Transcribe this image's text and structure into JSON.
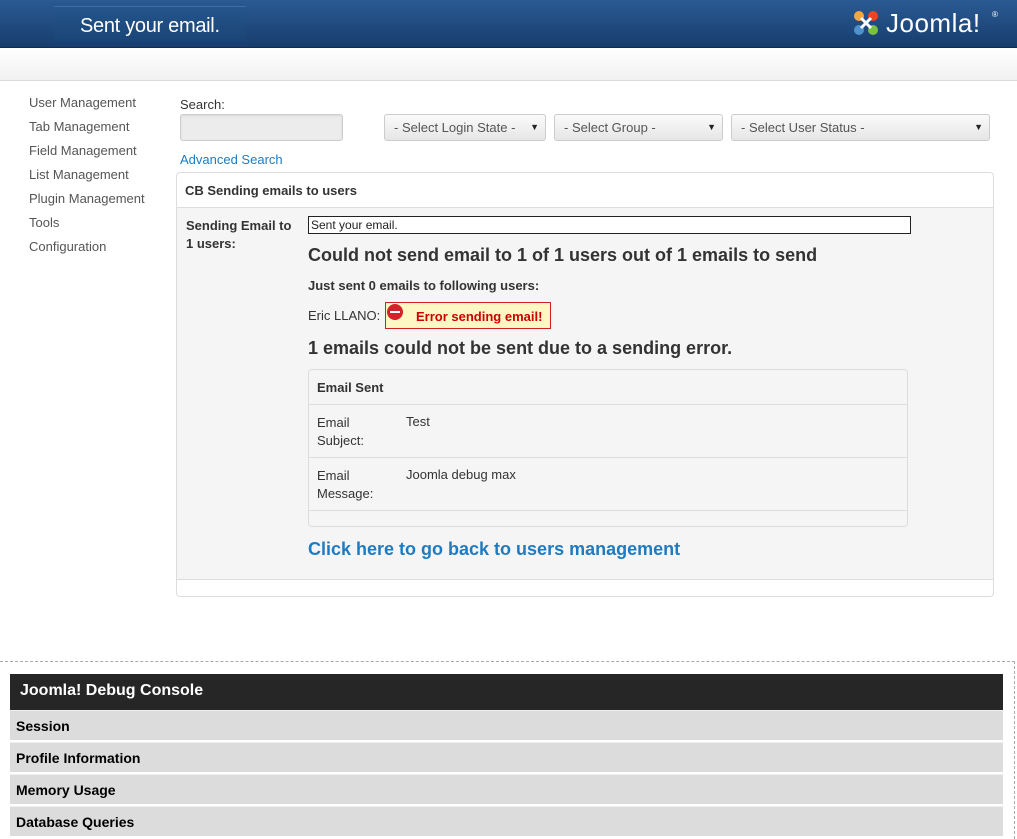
{
  "header": {
    "page_title": "Sent your email.",
    "logo_text": "Joomla!",
    "logo_mark": "®"
  },
  "sidebar": {
    "items": [
      {
        "label": "User Management"
      },
      {
        "label": "Tab Management"
      },
      {
        "label": "Field Management"
      },
      {
        "label": "List Management"
      },
      {
        "label": "Plugin Management"
      },
      {
        "label": "Tools"
      },
      {
        "label": "Configuration"
      }
    ]
  },
  "filters": {
    "search_label": "Search:",
    "search_value": "",
    "login_state": "- Select Login State -",
    "group": "- Select Group -",
    "user_status": "- Select User Status -",
    "advanced_search": "Advanced Search"
  },
  "panel": {
    "title": "CB Sending emails to users",
    "send_label": "Sending Email to 1 users:",
    "subject_line": "Sent your email.",
    "fail_heading": "Could not send email to 1 of 1 users out of 1 emails to send",
    "just_sent": "Just sent 0 emails to following users:",
    "user_name": "Eric LLANO:",
    "error_text": "Error sending email!",
    "not_sent_heading": "1 emails could not be sent due to a sending error.",
    "back_link": "Click here to go back to users management"
  },
  "email_sent": {
    "title": "Email Sent",
    "rows": [
      {
        "key": "Email Subject:",
        "value": "Test"
      },
      {
        "key": "Email Message:",
        "value": "Joomla debug max"
      }
    ]
  },
  "debug": {
    "title": "Joomla! Debug Console",
    "items": [
      {
        "label": "Session"
      },
      {
        "label": "Profile Information"
      },
      {
        "label": "Memory Usage"
      },
      {
        "label": "Database Queries"
      }
    ]
  },
  "colors": {
    "header_blue": "#1f4b80",
    "link_blue": "#1f7bc1",
    "error_red": "#cc0000",
    "debug_dark": "#262626"
  }
}
